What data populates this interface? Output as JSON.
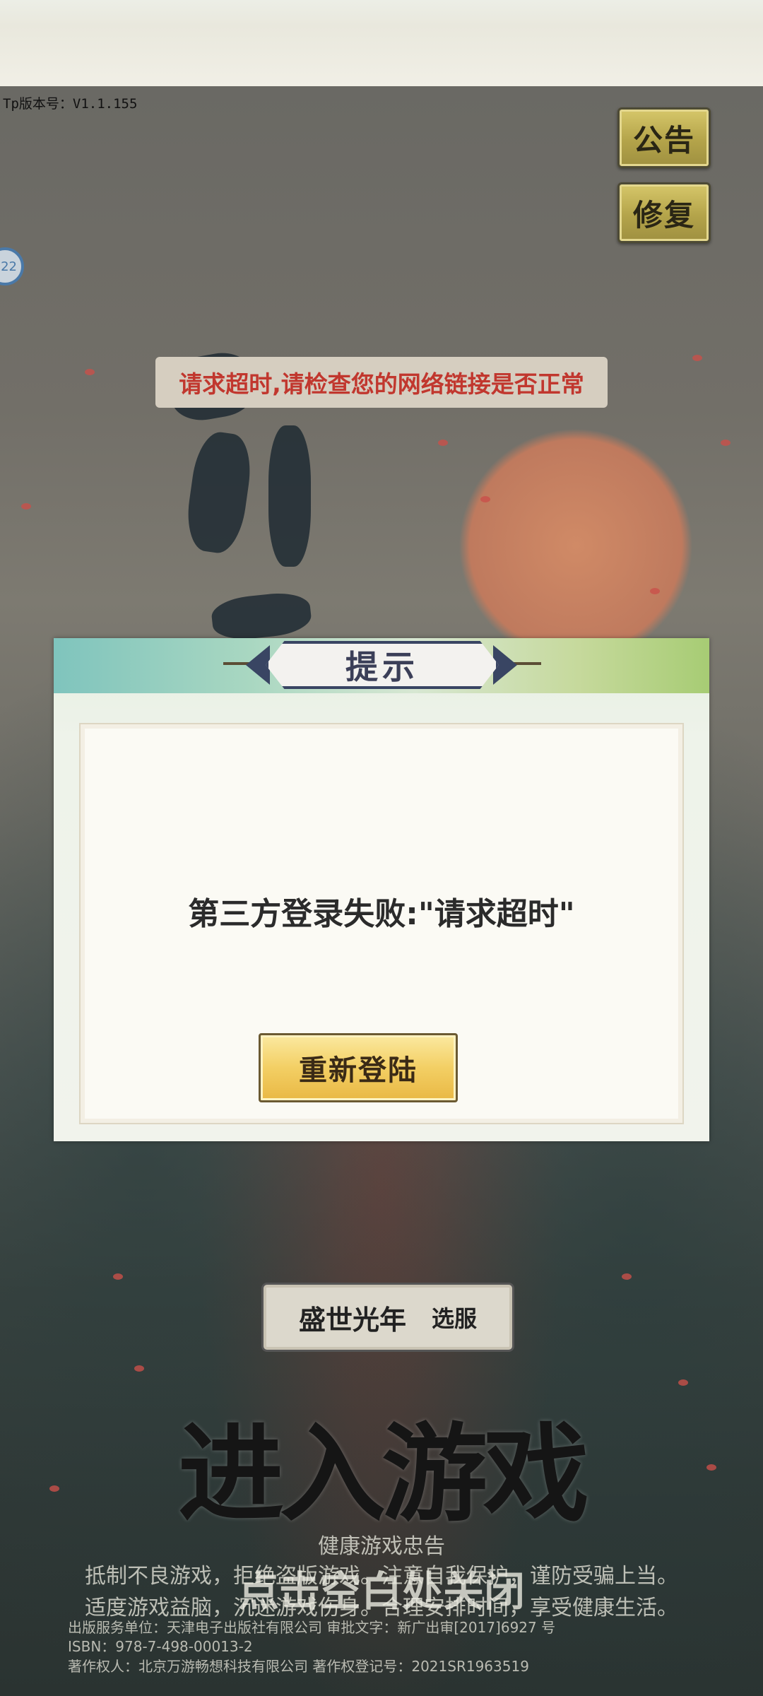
{
  "version": "Tp版本号：V1.1.155",
  "side_buttons": {
    "notice": "公告",
    "repair": "修复"
  },
  "avatar_text": "22",
  "toast": "请求超时,请检查您的网络链接是否正常",
  "dialog": {
    "title": "提示",
    "message": "第三方登录失败:\"请求超时\"",
    "relogin_label": "重新登陆"
  },
  "server": {
    "name": "盛世光年",
    "select_label": "选服"
  },
  "enter_game": "进入游戏",
  "close_hint": "点击空白处关闭",
  "health_advisory": {
    "title": "健康游戏忠告",
    "line1": "抵制不良游戏，拒绝盗版游戏。注意自我保护，谨防受骗上当。",
    "line2": "适度游戏益脑，沉迷游戏伤身。合理安排时间，享受健康生活。"
  },
  "legal": {
    "line1": "出版服务单位：天津电子出版社有限公司  审批文字：新广出审[2017]6927 号",
    "line2": "ISBN：978-7-498-00013-2",
    "line3": "著作权人：北京万游畅想科技有限公司  著作权登记号：2021SR1963519"
  },
  "colors": {
    "toast_text": "#c1372e",
    "dialog_title_frame": "#394563",
    "button_gold": "#f3cf64"
  }
}
